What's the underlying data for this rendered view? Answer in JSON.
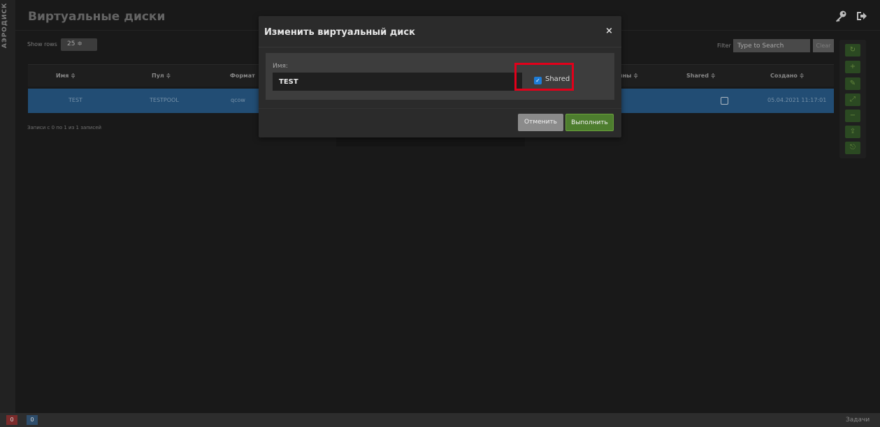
{
  "app": {
    "logo": "АЭРОДИСК",
    "title": "Виртуальные диски"
  },
  "toolbar": {
    "show_rows_label": "Show rows",
    "rows_value": "25 ≑",
    "filter_label": "Filter",
    "filter_placeholder": "Type to Search",
    "clear_label": "Clear"
  },
  "table": {
    "headers": [
      "Имя ≑",
      "Пул ≑",
      "Формат",
      "ины ≑",
      "Shared ≑",
      "Создано ≑"
    ],
    "row": {
      "name": "TEST",
      "pool": "TESTPOOL",
      "format": "qcow",
      "created": "05.04.2021 11:17:01"
    },
    "records_info": "Записи с 0 по 1 из 1 записей"
  },
  "modal": {
    "title": "Изменить виртуальный диск",
    "close": "×",
    "name_label": "Имя:",
    "name_value": "TEST",
    "shared_label": "Shared",
    "shared_checked": true,
    "cancel_label": "Отменить",
    "submit_label": "Выполнить"
  },
  "statusbar": {
    "errors": "0",
    "info": "0",
    "tasks_label": "Задачи"
  },
  "icons": {
    "side_tools": [
      "refresh-icon",
      "add-icon",
      "edit-icon",
      "resize-icon",
      "remove-icon",
      "upload-icon",
      "clone-icon"
    ],
    "side_glyphs": [
      "↻",
      "+",
      "✎",
      "⤢",
      "−",
      "⇪",
      "⎋"
    ]
  },
  "colors": {
    "accent_green": "#4d7d2e",
    "selected_row": "#2a5e8e",
    "highlight": "#e2001a"
  }
}
